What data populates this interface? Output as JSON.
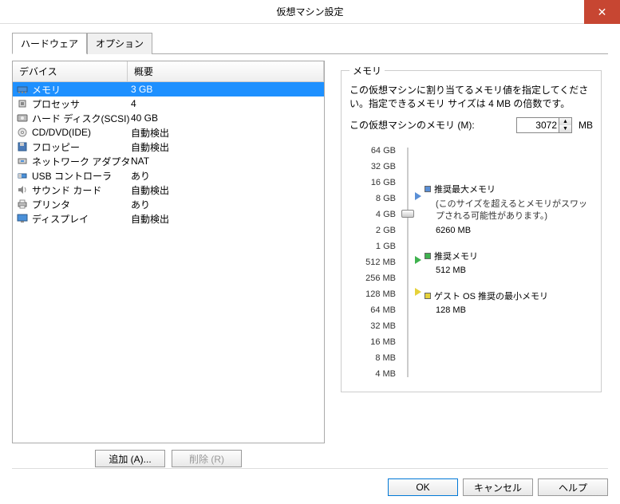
{
  "title": "仮想マシン設定",
  "tabs": {
    "hardware": "ハードウェア",
    "options": "オプション"
  },
  "table": {
    "header_device": "デバイス",
    "header_summary": "概要",
    "rows": [
      {
        "name": "メモリ",
        "summary": "3 GB",
        "icon": "memory"
      },
      {
        "name": "プロセッサ",
        "summary": "4",
        "icon": "cpu"
      },
      {
        "name": "ハード ディスク(SCSI)",
        "summary": "40 GB",
        "icon": "hdd"
      },
      {
        "name": "CD/DVD(IDE)",
        "summary": "自動検出",
        "icon": "cd"
      },
      {
        "name": "フロッピー",
        "summary": "自動検出",
        "icon": "floppy"
      },
      {
        "name": "ネットワーク アダプタ",
        "summary": "NAT",
        "icon": "net"
      },
      {
        "name": "USB コントローラ",
        "summary": "あり",
        "icon": "usb"
      },
      {
        "name": "サウンド カード",
        "summary": "自動検出",
        "icon": "sound"
      },
      {
        "name": "プリンタ",
        "summary": "あり",
        "icon": "printer"
      },
      {
        "name": "ディスプレイ",
        "summary": "自動検出",
        "icon": "display"
      }
    ]
  },
  "buttons": {
    "add": "追加 (A)...",
    "remove": "削除 (R)",
    "ok": "OK",
    "cancel": "キャンセル",
    "help": "ヘルプ"
  },
  "memory": {
    "legend": "メモリ",
    "desc": "この仮想マシンに割り当てるメモリ値を指定してください。指定できるメモリ サイズは 4 MB の倍数です。",
    "label": "この仮想マシンのメモリ (M):",
    "value": "3072",
    "unit": "MB",
    "ticks": [
      "64 GB",
      "32 GB",
      "16 GB",
      "8 GB",
      "4 GB",
      "2 GB",
      "1 GB",
      "512 MB",
      "256 MB",
      "128 MB",
      "64 MB",
      "32 MB",
      "16 MB",
      "8 MB",
      "4 MB"
    ],
    "rec_max": {
      "label": "推奨最大メモリ",
      "note": "(このサイズを超えるとメモリがスワップされる可能性があります。)",
      "value": "6260 MB",
      "color": "#5a8fd6"
    },
    "rec": {
      "label": "推奨メモリ",
      "value": "512 MB",
      "color": "#3fb24f"
    },
    "rec_min": {
      "label": "ゲスト OS 推奨の最小メモリ",
      "value": "128 MB",
      "color": "#e6d23a"
    }
  }
}
